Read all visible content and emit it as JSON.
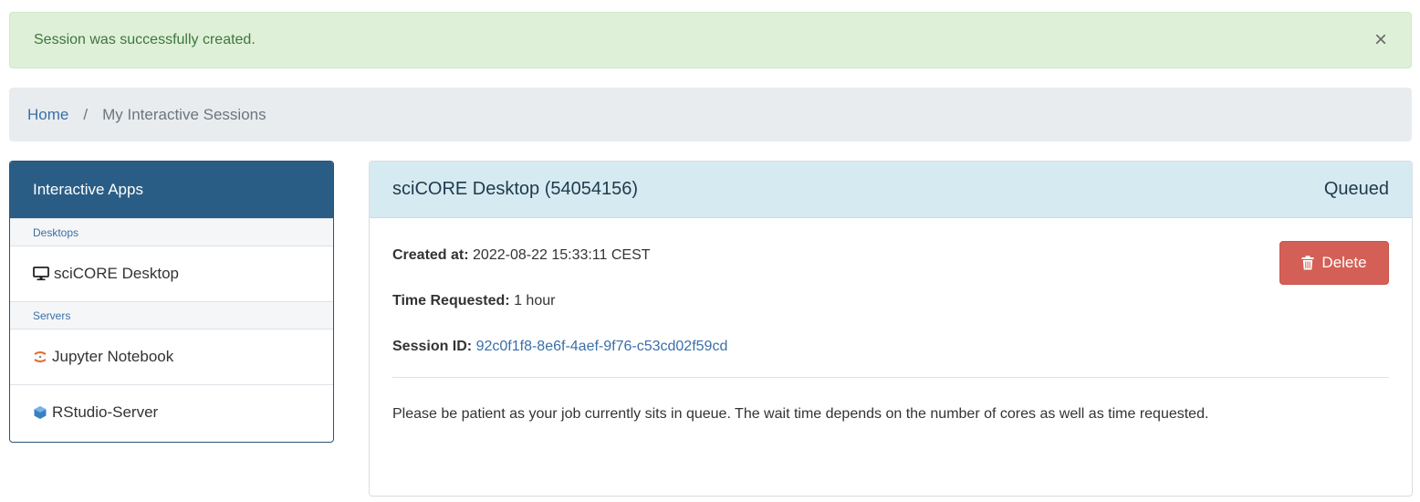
{
  "alert": {
    "message": "Session was successfully created.",
    "close_label": "×"
  },
  "breadcrumb": {
    "home": "Home",
    "separator": "/",
    "current": "My Interactive Sessions"
  },
  "sidebar": {
    "title": "Interactive Apps",
    "groups": [
      {
        "label": "Desktops",
        "items": [
          {
            "label": "sciCORE Desktop",
            "icon": "monitor-icon"
          }
        ]
      },
      {
        "label": "Servers",
        "items": [
          {
            "label": "Jupyter Notebook",
            "icon": "jupyter-icon"
          },
          {
            "label": "RStudio-Server",
            "icon": "rstudio-icon"
          }
        ]
      }
    ]
  },
  "session": {
    "title": "sciCORE Desktop (54054156)",
    "status": "Queued",
    "created_label": "Created at:",
    "created_value": "2022-08-22 15:33:11 CEST",
    "time_label": "Time Requested:",
    "time_value": "1 hour",
    "id_label": "Session ID:",
    "id_value": "92c0f1f8-8e6f-4aef-9f76-c53cd02f59cd",
    "delete_label": "Delete",
    "message": "Please be patient as your job currently sits in queue. The wait time depends on the number of cores as well as time requested."
  },
  "colors": {
    "alert_bg": "#dff0d8",
    "sidebar_header": "#2a5d85",
    "card_header": "#d6ebf1",
    "delete_button": "#d45f56",
    "link": "#3a6fa8"
  }
}
